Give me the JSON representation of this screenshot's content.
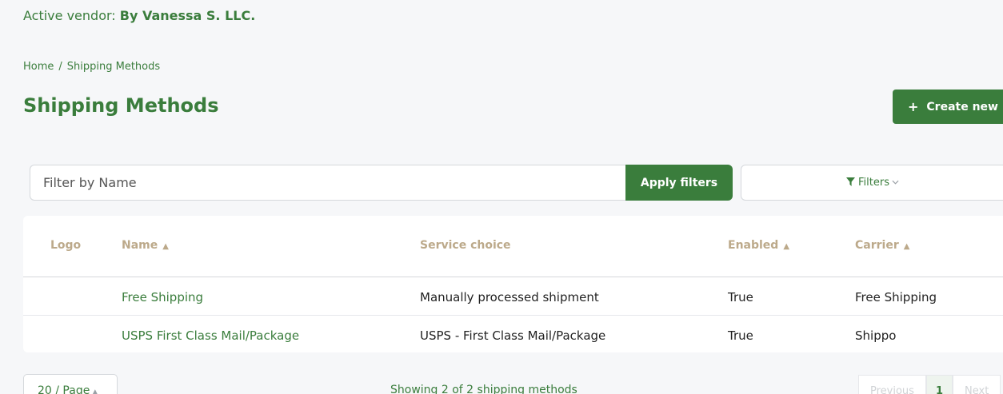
{
  "header": {
    "vendor_prefix": "Active vendor: ",
    "vendor_name": "By Vanessa S. LLC."
  },
  "breadcrumb": {
    "home": "Home",
    "separator": "/",
    "current": "Shipping Methods"
  },
  "page": {
    "title": "Shipping Methods",
    "create_label": "Create new"
  },
  "filters": {
    "name_placeholder": "Filter by Name",
    "apply_label": "Apply filters",
    "filters_label": "Filters"
  },
  "table": {
    "columns": {
      "logo": "Logo",
      "name": "Name",
      "service": "Service choice",
      "enabled": "Enabled",
      "carrier": "Carrier"
    },
    "rows": [
      {
        "name": "Free Shipping",
        "service": "Manually processed shipment",
        "enabled": "True",
        "carrier": "Free Shipping"
      },
      {
        "name": "USPS First Class Mail/Package",
        "service": "USPS - First Class Mail/Package",
        "enabled": "True",
        "carrier": "Shippo"
      }
    ]
  },
  "footer": {
    "page_size": "20 / Page",
    "showing": "Showing 2 of 2 shipping methods",
    "previous": "Previous",
    "current_page": "1",
    "next": "Next"
  },
  "colors": {
    "brand_green": "#3a7d3c",
    "header_text": "#bca98a",
    "background": "#f6f7f9"
  }
}
